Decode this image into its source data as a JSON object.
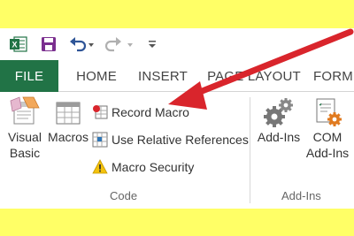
{
  "colors": {
    "accent": "#217346",
    "highlight_band": "#ffff66",
    "annotation_arrow": "#d9252c"
  },
  "qat": {
    "icons": [
      "excel-logo-icon",
      "save-icon",
      "undo-icon",
      "redo-icon",
      "customize-qat-icon"
    ]
  },
  "tabs": [
    {
      "label": "FILE"
    },
    {
      "label": "HOME"
    },
    {
      "label": "INSERT"
    },
    {
      "label": "PAGE LAYOUT"
    },
    {
      "label": "FORMU"
    }
  ],
  "code_group": {
    "visual_basic": {
      "line1": "Visual",
      "line2": "Basic"
    },
    "macros": {
      "label": "Macros"
    },
    "record_macro": {
      "label": "Record Macro"
    },
    "relative_refs": {
      "label": "Use Relative References"
    },
    "macro_security": {
      "label": "Macro Security"
    },
    "group_label": "Code"
  },
  "addins_group": {
    "addins": {
      "line1": "Add-Ins"
    },
    "com_addins": {
      "line1": "COM",
      "line2": "Add-Ins"
    },
    "group_label": "Add-Ins"
  }
}
